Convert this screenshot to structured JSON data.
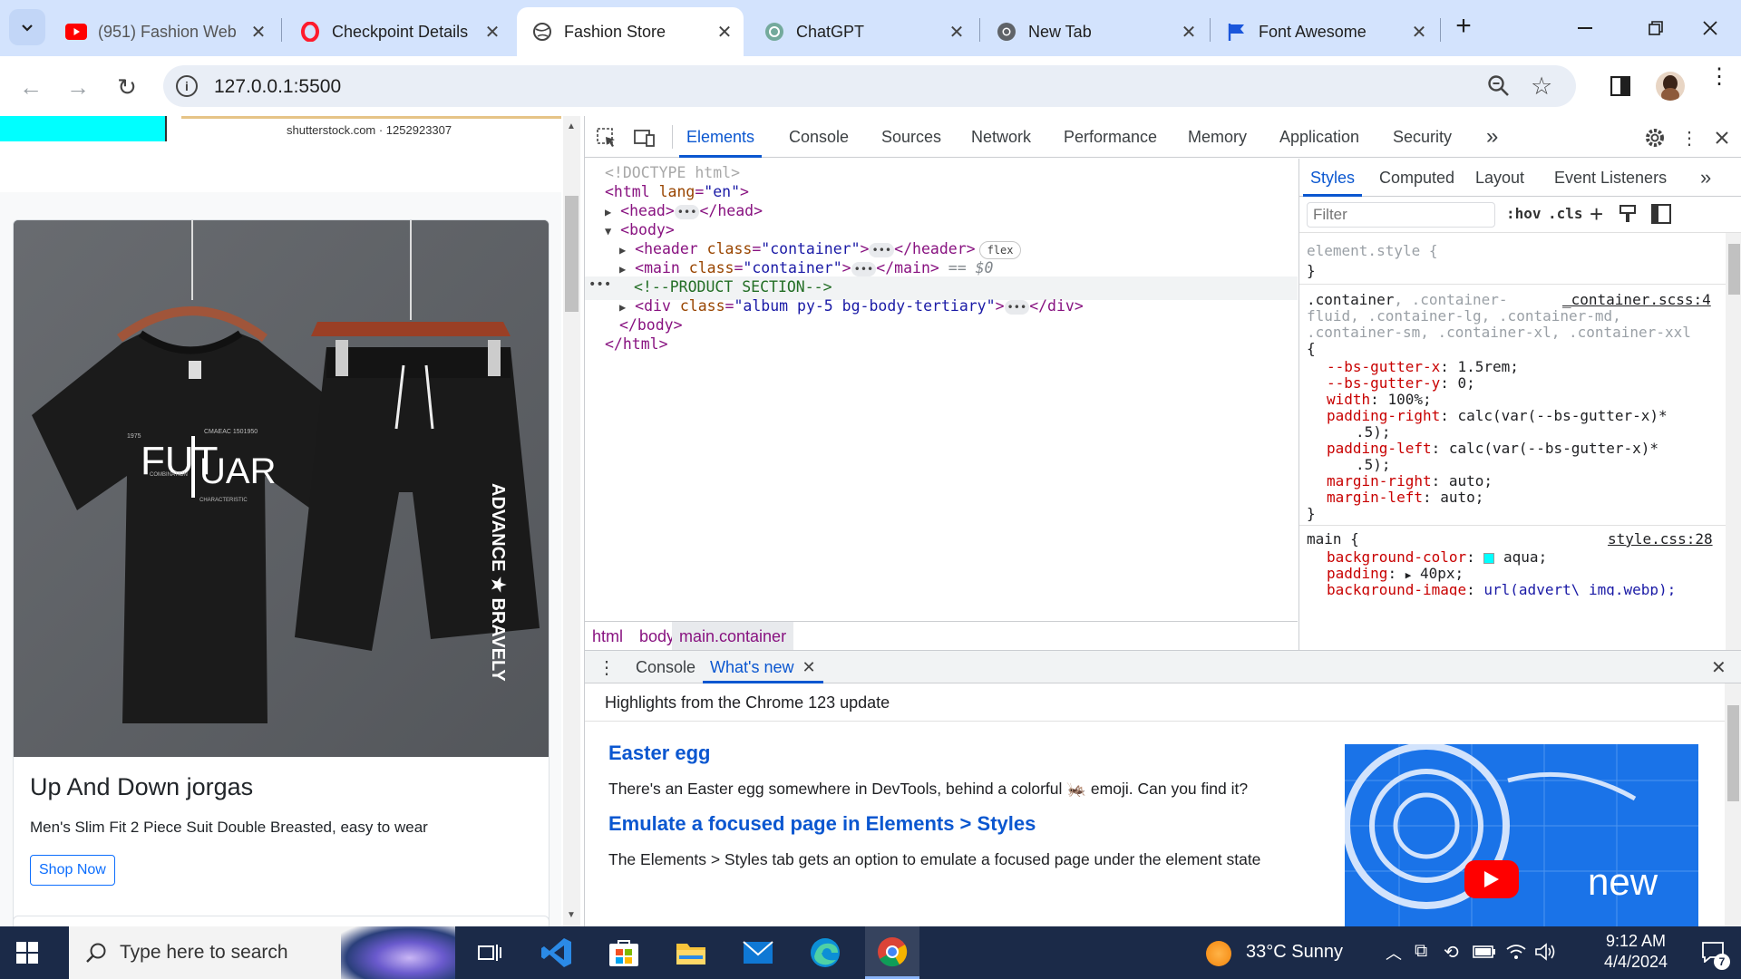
{
  "browser": {
    "tabs": [
      {
        "title": "(951) Fashion Web",
        "icon": "youtube-icon",
        "active": false
      },
      {
        "title": "Checkpoint Details",
        "icon": "opera-icon",
        "active": false
      },
      {
        "title": "Fashion Store",
        "icon": "globe-icon",
        "active": true
      },
      {
        "title": "ChatGPT",
        "icon": "chatgpt-icon",
        "active": false
      },
      {
        "title": "New Tab",
        "icon": "chrome-icon",
        "active": false
      },
      {
        "title": "Font Awesome",
        "icon": "flag-icon",
        "active": false
      }
    ],
    "url": "127.0.0.1:5500"
  },
  "page": {
    "watermark": "shutterstock.com · 1252923307",
    "card": {
      "shirt_print": "FUT UAR",
      "shorts_print": "ADVANCE ★ BRAVELY",
      "title": "Up And Down jorgas",
      "text": "Men's Slim Fit 2 Piece Suit Double Breasted, easy to wear",
      "button": "Shop Now"
    }
  },
  "devtools": {
    "tabs": [
      "Elements",
      "Console",
      "Sources",
      "Network",
      "Performance",
      "Memory",
      "Application",
      "Security"
    ],
    "more": "»",
    "dom": {
      "doctype": "<!DOCTYPE html>",
      "html_open_tag": "<html",
      "html_lang_attr": "lang",
      "html_lang_val": "\"en\"",
      "head_open": "<head>",
      "head_close": "</head>",
      "body_open": "<body>",
      "header_tag": "<header",
      "header_close": "</header>",
      "class_attr": "class",
      "container_val": "\"container\"",
      "flex_badge": "flex",
      "main_tag": "<main",
      "main_close": "</main>",
      "selected_marker": "== $0",
      "comment": "<!--PRODUCT SECTION-->",
      "div_tag": "<div",
      "div_class_val": "\"album py-5 bg-body-tertiary\"",
      "div_close": "</div>",
      "body_close": "</body>",
      "html_close": "</html>",
      "ellipsis": "•••",
      "gt": ">"
    },
    "breadcrumbs": [
      "html",
      "body",
      "main.container"
    ],
    "styles": {
      "tabs": [
        "Styles",
        "Computed",
        "Layout",
        "Event Listeners"
      ],
      "filter_placeholder": "Filter",
      "hov": ":hov",
      "cls": ".cls",
      "element_style": "element.style {",
      "close_brace": "}",
      "rule1_selector": ".container",
      "rule1_dim_1": ", .container-",
      "rule1_dim_2": "fluid, .container-lg, .container-md,",
      "rule1_dim_3": ".container-sm, .container-xl, .container-xxl",
      "rule1_source": "_container.scss:4",
      "open_brace": "{",
      "props1": [
        {
          "name": "--bs-gutter-x",
          "value": "1.5rem;"
        },
        {
          "name": "--bs-gutter-y",
          "value": "0;"
        },
        {
          "name": "width",
          "value": "100%;"
        },
        {
          "name": "padding-right",
          "value": "calc(var(--bs-gutter-x)*",
          "cont": ".5);"
        },
        {
          "name": "padding-left",
          "value": "calc(var(--bs-gutter-x)*",
          "cont": ".5);"
        },
        {
          "name": "margin-right",
          "value": "auto;"
        },
        {
          "name": "margin-left",
          "value": "auto;"
        }
      ],
      "rule2_selector": "main {",
      "rule2_source": "style.css:28",
      "props2": [
        {
          "name": "background-color",
          "value": "aqua;"
        },
        {
          "name": "padding",
          "value": "40px;"
        },
        {
          "name": "background-image",
          "value": "url(advert\\ img.webp);"
        }
      ],
      "aqua_swatch": "#00ffff"
    },
    "drawer": {
      "tabs": [
        "Console",
        "What's new"
      ],
      "header": "Highlights from the Chrome 123 update",
      "items": [
        {
          "heading": "Easter egg",
          "text": "There's an Easter egg somewhere in DevTools, behind a colorful 🦗 emoji. Can you find it?"
        },
        {
          "heading": "Emulate a focused page in Elements > Styles",
          "text": "The Elements > Styles tab gets an option to emulate a focused page under the element state"
        }
      ],
      "video_label": "new"
    }
  },
  "taskbar": {
    "search_placeholder": "Type here to search",
    "weather": "33°C  Sunny",
    "time": "9:12 AM",
    "date": "4/4/2024",
    "notification_count": "7"
  },
  "colors": {
    "accent": "#0b57d0",
    "tabstrip": "#d3e3fd",
    "taskbar": "#1b2a48",
    "aqua": "#00ffff"
  }
}
